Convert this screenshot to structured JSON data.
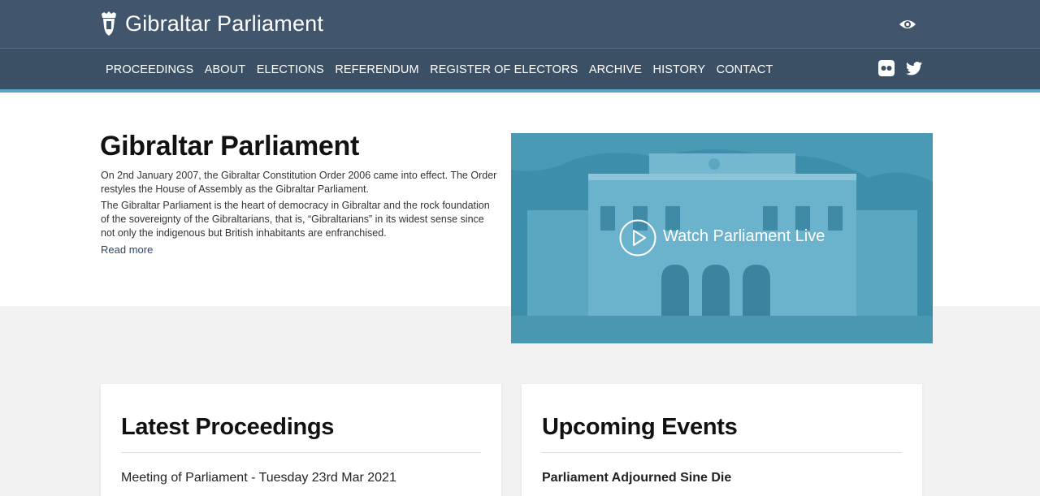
{
  "header": {
    "site_title": "Gibraltar Parliament",
    "logo_icon": "crest-icon",
    "accessibility_icon": "eye-icon"
  },
  "nav": {
    "items": [
      {
        "label": "PROCEEDINGS"
      },
      {
        "label": "ABOUT"
      },
      {
        "label": "ELECTIONS"
      },
      {
        "label": "REFERENDUM"
      },
      {
        "label": "REGISTER OF ELECTORS"
      },
      {
        "label": "ARCHIVE"
      },
      {
        "label": "HISTORY"
      },
      {
        "label": "CONTACT"
      }
    ],
    "social": [
      "flickr-icon",
      "twitter-icon"
    ]
  },
  "hero": {
    "title": "Gibraltar Parliament",
    "paragraph1": "On 2nd January 2007, the Gibraltar Constitution Order 2006 came into effect. The Order restyles the House of Assembly as the Gibraltar Parliament.",
    "paragraph2": "The Gibraltar Parliament is the heart of democracy in Gibraltar and the rock foundation of the sovereignty of the Gibraltarians, that is, “Gibraltarians” in its widest sense since not only the indigenous but British inhabitants are enfranchised.",
    "read_more": "Read more",
    "video_label": "Watch Parliament Live"
  },
  "cards": {
    "latest_title": "Latest Proceedings",
    "latest_item": "Meeting of Parliament - Tuesday 23rd Mar 2021",
    "upcoming_title": "Upcoming Events",
    "upcoming_item": "Parliament Adjourned Sine Die"
  },
  "colors": {
    "header_bg": "#41566d",
    "nav_bg": "#3b4f65",
    "accent": "#5ba6c8",
    "video_tint": "#3d8eab"
  }
}
